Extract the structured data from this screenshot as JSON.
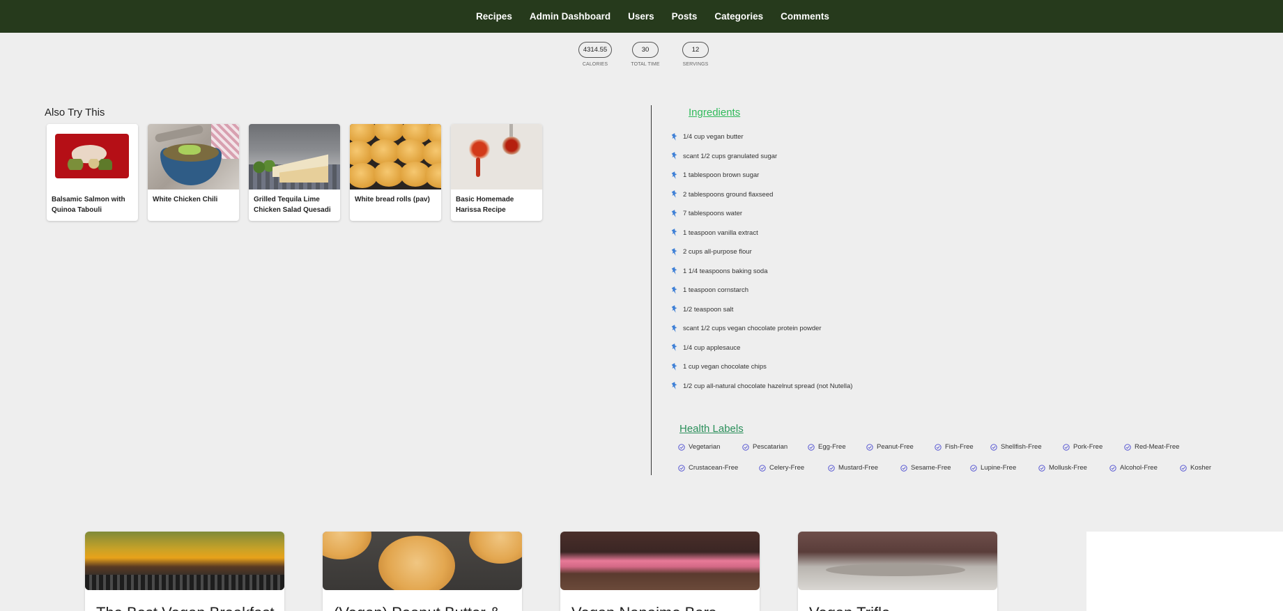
{
  "nav": {
    "items": [
      "Recipes",
      "Admin Dashboard",
      "Users",
      "Posts",
      "Categories",
      "Comments"
    ]
  },
  "stats": [
    {
      "value": "4314.55",
      "label": "CALORIES"
    },
    {
      "value": "30",
      "label": "TOTAL TIME"
    },
    {
      "value": "12",
      "label": "SERVINGS"
    }
  ],
  "also_try": {
    "title": "Also Try This",
    "cards": [
      {
        "title": "Balsamic Salmon with Quinoa Tabouli"
      },
      {
        "title": "White Chicken Chili"
      },
      {
        "title": "Grilled Tequila Lime Chicken Salad Quesadi"
      },
      {
        "title": "White bread rolls (pav)"
      },
      {
        "title": "Basic Homemade Harissa Recipe"
      }
    ]
  },
  "ingredients": {
    "title": "Ingredients",
    "items": [
      "1/4 cup vegan butter",
      "scant 1/2 cups granulated sugar",
      "1 tablespoon brown sugar",
      "2 tablespoons ground flaxseed",
      "7 tablespoons water",
      "1 teaspoon vanilla extract",
      "2 cups all-purpose flour",
      "1 1/4 teaspoons baking soda",
      "1 teaspoon cornstarch",
      "1/2 teaspoon salt",
      "scant 1/2 cups vegan chocolate protein powder",
      "1/4 cup applesauce",
      "1 cup vegan chocolate chips",
      "1/2 cup all-natural chocolate hazelnut spread (not Nutella)"
    ],
    "icon": "pin-icon"
  },
  "health_labels": {
    "title": "Health Labels",
    "row1": [
      "Vegetarian",
      "Pescatarian",
      "Egg-Free",
      "Peanut-Free",
      "Fish-Free",
      "Shellfish-Free",
      "Pork-Free",
      "Red-Meat-Free"
    ],
    "row2": [
      "Crustacean-Free",
      "Celery-Free",
      "Mustard-Free",
      "Sesame-Free",
      "Lupine-Free",
      "Mollusk-Free",
      "Alcohol-Free",
      "Kosher"
    ],
    "icon": "check-circle-icon"
  },
  "bottom_cards": [
    {
      "title": "The Best Vegan Breakfast"
    },
    {
      "title": "(Vegan) Peanut Butter &"
    },
    {
      "title": "Vegan Nanaimo Bars"
    },
    {
      "title": "Vegan Trifle"
    }
  ],
  "colors": {
    "nav_bg": "#263a1c",
    "page_bg": "#eeeeee",
    "ingredients_title": "#2fba5a",
    "health_title": "#2a8f5a",
    "pin": "#3d7fd6",
    "check": "#4a4ad0"
  }
}
